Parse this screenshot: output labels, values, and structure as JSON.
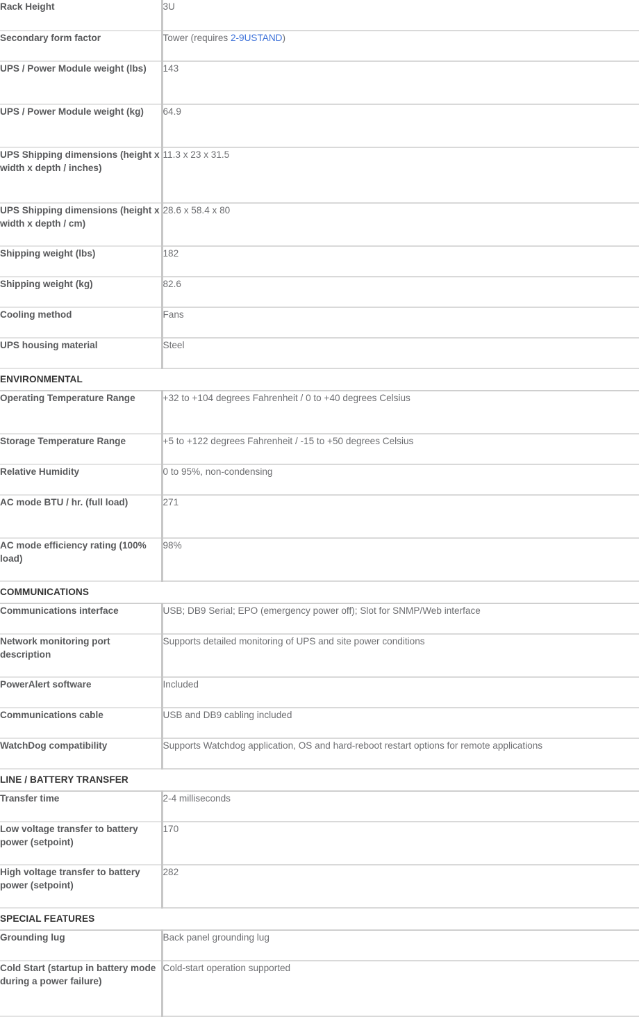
{
  "page": {
    "title": "UPS Specifications Table",
    "link_color": "#3a6fd8",
    "label_color": "#58595b",
    "value_color": "#6d6e71",
    "section_color": "#333333"
  },
  "rows": [
    {
      "kind": "spec",
      "lines": 1,
      "label": "Rack Height",
      "value": "3U"
    },
    {
      "kind": "spec",
      "lines": 1,
      "label": "Secondary form factor",
      "value": "Tower (requires 2-9USTAND)",
      "value_prefix": "Tower (requires ",
      "value_link": "2-9USTAND",
      "value_suffix": ")"
    },
    {
      "kind": "spec",
      "lines": 2,
      "label": "UPS / Power Module weight (lbs)",
      "value": "143"
    },
    {
      "kind": "spec",
      "lines": 2,
      "label": "UPS / Power Module weight (kg)",
      "value": "64.9"
    },
    {
      "kind": "spec",
      "lines": 3,
      "label": "UPS Shipping dimensions (height x width x depth / inches)",
      "value": "11.3 x 23 x 31.5"
    },
    {
      "kind": "spec",
      "lines": 2,
      "label": "UPS Shipping dimensions (height x width x depth / cm)",
      "value": "28.6 x 58.4 x 80"
    },
    {
      "kind": "spec",
      "lines": 1,
      "label": "Shipping weight (lbs)",
      "value": "182"
    },
    {
      "kind": "spec",
      "lines": 1,
      "label": "Shipping weight (kg)",
      "value": "82.6"
    },
    {
      "kind": "spec",
      "lines": 1,
      "label": "Cooling method",
      "value": "Fans"
    },
    {
      "kind": "spec",
      "lines": 1,
      "label": "UPS housing material",
      "value": "Steel"
    },
    {
      "kind": "section",
      "label": "ENVIRONMENTAL"
    },
    {
      "kind": "spec",
      "lines": 2,
      "label": "Operating Temperature Range",
      "value": "+32 to +104 degrees Fahrenheit / 0 to +40 degrees Celsius"
    },
    {
      "kind": "spec",
      "lines": 1,
      "label": "Storage Temperature Range",
      "value": "+5 to +122 degrees Fahrenheit / -15 to +50 degrees Celsius"
    },
    {
      "kind": "spec",
      "lines": 1,
      "label": "Relative Humidity",
      "value": "0 to 95%, non-condensing"
    },
    {
      "kind": "spec",
      "lines": 2,
      "label": "AC mode BTU / hr. (full load)",
      "value": "271"
    },
    {
      "kind": "spec",
      "lines": 2,
      "label": "AC mode efficiency rating (100% load)",
      "value": "98%"
    },
    {
      "kind": "section",
      "label": "COMMUNICATIONS"
    },
    {
      "kind": "spec",
      "lines": 1,
      "label": "Communications interface",
      "value": "USB; DB9 Serial; EPO (emergency power off); Slot for SNMP/Web interface"
    },
    {
      "kind": "spec",
      "lines": 2,
      "label": "Network monitoring port description",
      "value": "Supports detailed monitoring of UPS and site power conditions"
    },
    {
      "kind": "spec",
      "lines": 1,
      "label": "PowerAlert software",
      "value": "Included"
    },
    {
      "kind": "spec",
      "lines": 1,
      "label": "Communications cable",
      "value": "USB and DB9 cabling included"
    },
    {
      "kind": "spec",
      "lines": 1,
      "label": "WatchDog compatibility",
      "value": "Supports Watchdog application, OS and hard-reboot restart options for remote applications"
    },
    {
      "kind": "section",
      "label": "LINE / BATTERY TRANSFER"
    },
    {
      "kind": "spec",
      "lines": 1,
      "label": "Transfer time",
      "value": "2-4 milliseconds"
    },
    {
      "kind": "spec",
      "lines": 2,
      "label": "Low voltage transfer to battery power (setpoint)",
      "value": "170"
    },
    {
      "kind": "spec",
      "lines": 2,
      "label": "High voltage transfer to battery power (setpoint)",
      "value": "282"
    },
    {
      "kind": "section",
      "label": "SPECIAL FEATURES"
    },
    {
      "kind": "spec",
      "lines": 1,
      "label": "Grounding lug",
      "value": "Back panel grounding lug"
    },
    {
      "kind": "spec",
      "lines": 3,
      "label": "Cold Start (startup in battery mode during a power failure)",
      "value": "Cold-start operation supported"
    }
  ]
}
